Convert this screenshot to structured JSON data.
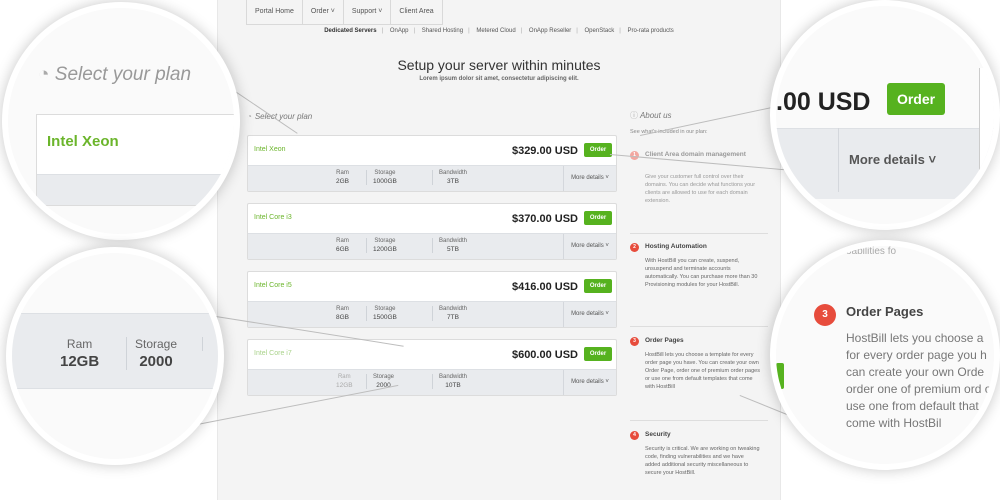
{
  "nav": {
    "items": [
      "Portal Home",
      "Order ˅",
      "Support ˅",
      "Client Area"
    ]
  },
  "subnav": {
    "items": [
      "Dedicated Servers",
      "OnApp",
      "Shared Hosting",
      "Metered Cloud",
      "OnApp Reseller",
      "OpenStack",
      "Pro-rata products"
    ]
  },
  "hero": {
    "title": "Setup your server within minutes",
    "subtitle": "Lorem ipsum dolor sit amet, consectetur adipiscing elit."
  },
  "plans_section": {
    "label": "Select your plan"
  },
  "spec_labels": {
    "ram": "Ram",
    "storage": "Storage",
    "bandwidth": "Bandwidth"
  },
  "plans": [
    {
      "name": "Intel Xeon",
      "price": "$329.00 USD",
      "order": "Order",
      "ram": "2GB",
      "storage": "1000GB",
      "bandwidth": "3TB",
      "more": "More details ˅"
    },
    {
      "name": "Intel Core i3",
      "price": "$370.00 USD",
      "order": "Order",
      "ram": "6GB",
      "storage": "1200GB",
      "bandwidth": "5TB",
      "more": "More details ˅"
    },
    {
      "name": "Intel Core i5",
      "price": "$416.00 USD",
      "order": "Order",
      "ram": "8GB",
      "storage": "1500GB",
      "bandwidth": "7TB",
      "more": "More details ˅"
    },
    {
      "name": "Intel Core i7",
      "price": "$600.00 USD",
      "order": "Order",
      "ram": "12GB",
      "storage": "2000",
      "bandwidth": "10TB",
      "more": "More details ˅"
    }
  ],
  "about": {
    "title": "About us",
    "intro": "See what's included in our plan:",
    "features": [
      {
        "num": "1",
        "title": "Client Area domain management",
        "desc": "Give your customer full control over their domains. You can decide what functions your clients are allowed to use for each domain extension."
      },
      {
        "num": "2",
        "title": "Hosting Automation",
        "desc": "With HostBill you can create, suspend, unsuspend and terminate accounts automatically. You can purchase more than 30 Provisioning modules for your HostBill."
      },
      {
        "num": "3",
        "title": "Order Pages",
        "desc": "HostBill lets you choose a template for every order page you have. You can create your own Order Page, order one of premium order pages or use one from default templates that come with HostBill"
      },
      {
        "num": "4",
        "title": "Security",
        "desc": "Security is critical. We are working on tweaking code, finding vulnerabilities and we have added additional security miscellaneous to secure your HostBill."
      }
    ]
  },
  "zoom": {
    "plan_label": "Select your plan",
    "plan_name": "Intel Xeon",
    "ram_label": "Ram",
    "ram_value": "12GB",
    "storage_label": "Storage",
    "storage_value": "2000",
    "price": ".00 USD",
    "order": "Order",
    "more": "More details ˅",
    "feature_num": "3",
    "feature_title": "Order Pages",
    "feature_desc": "HostBill lets you choose a for every order page you h can create your own Orde order one of premium ord or use one from default that come with HostBil",
    "top_fragment": "oabilities fo"
  },
  "colors": {
    "accent_green": "#56b21f",
    "plan_name_green": "#6bb52b",
    "badge_red": "#e74c3c"
  }
}
